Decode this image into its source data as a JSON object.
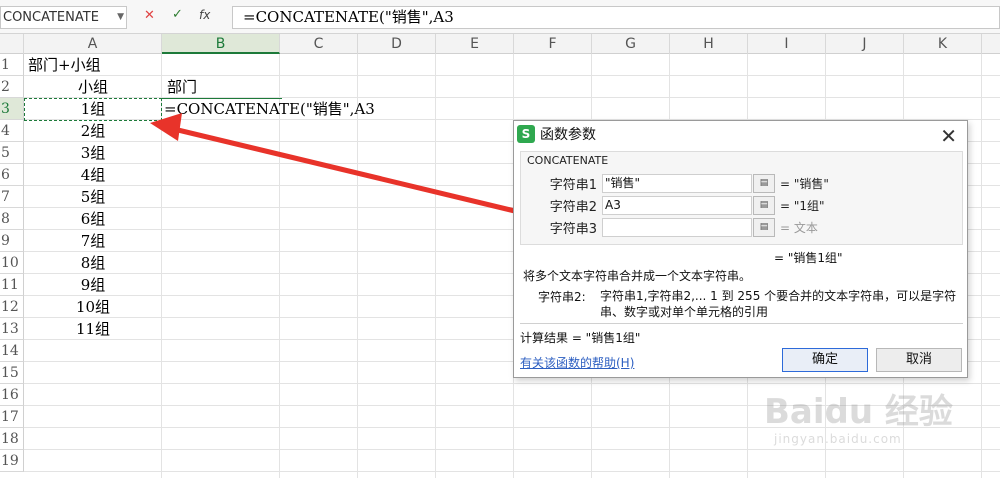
{
  "name_box": "CONCATENATE",
  "formula_bar": {
    "cancel_icon": "✕",
    "enter_icon": "✓",
    "fx_label": "fx",
    "formula": "=CONCATENATE(\"销售\",A3"
  },
  "columns": [
    "A",
    "B",
    "C",
    "D",
    "E",
    "F",
    "G",
    "H",
    "I",
    "J",
    "K"
  ],
  "rows": [
    "1",
    "2",
    "3",
    "4",
    "5",
    "6",
    "7",
    "8",
    "9",
    "10",
    "11",
    "12",
    "13",
    "14",
    "15",
    "16",
    "17",
    "18",
    "19"
  ],
  "cells": {
    "A1": "部门+小组",
    "A2": "小组",
    "B2": "部门",
    "A3": "1组",
    "B3": "=CONCATENATE(\"销售\",A3",
    "A4": "2组",
    "A5": "3组",
    "A6": "4组",
    "A7": "5组",
    "A8": "6组",
    "A9": "7组",
    "A10": "8组",
    "A11": "9组",
    "A12": "10组",
    "A13": "11组"
  },
  "dialog": {
    "logo": "S",
    "title": "函数参数",
    "close_icon": "✕",
    "function_name": "CONCATENATE",
    "args": [
      {
        "label": "字符串1",
        "value": "\"销售\"",
        "result": "= \"销售\""
      },
      {
        "label": "字符串2",
        "value": "A3",
        "result": "= \"1组\""
      },
      {
        "label": "字符串3",
        "value": "",
        "result": "= 文本"
      }
    ],
    "arg_button_icon": "▤",
    "formula_result": "= \"销售1组\"",
    "description": "将多个文本字符串合并成一个文本字符串。",
    "arg_desc_label": "字符串2:",
    "arg_desc_text": "字符串1,字符串2,... 1 到 255 个要合并的文本字符串，可以是字符串、数字或对单个单元格的引用",
    "calc_result": "计算结果 = \"销售1组\"",
    "help_link": "有关该函数的帮助(H)",
    "ok_label": "确定",
    "cancel_label": "取消"
  },
  "watermark": {
    "text": "Baidu 经验",
    "sub": "jingyan.baidu.com"
  },
  "colors": {
    "accent": "#1d7a3a",
    "arrow": "#e8332a",
    "link": "#2d5fc1"
  }
}
